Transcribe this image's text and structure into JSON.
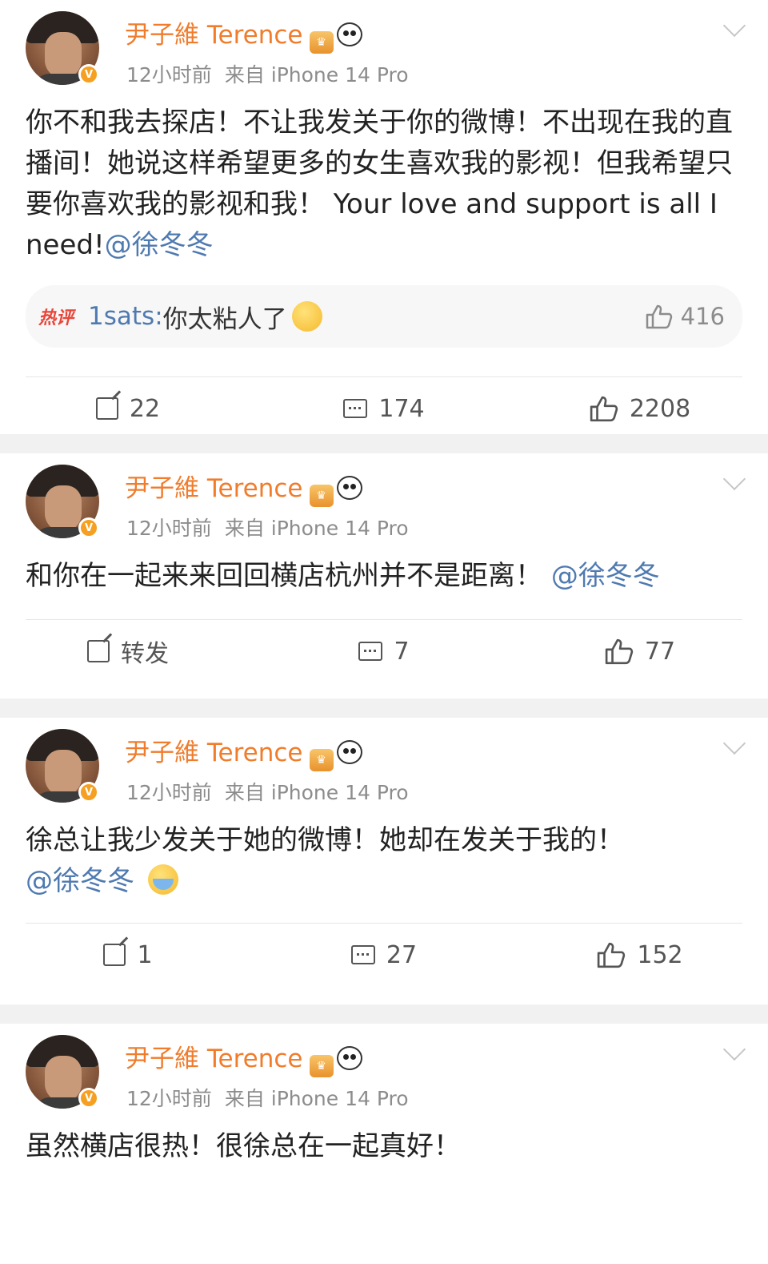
{
  "posts": [
    {
      "author": "尹子維 Terence",
      "time": "12小时前",
      "source": "来自 iPhone 14 Pro",
      "text": "你不和我去探店！不让我发关于你的微博！不出现在我的直播间！她说这样希望更多的女生喜欢我的影视！但我希望只要你喜欢我的影视和我！ Your love and support is all I need!",
      "mention": "@徐冬冬",
      "hot_comment": {
        "tag": "热评",
        "user": "1sats:",
        "text": " 你太粘人了",
        "likes": "416"
      },
      "share": "22",
      "comments": "174",
      "likes": "2208"
    },
    {
      "author": "尹子維 Terence",
      "time": "12小时前",
      "source": "来自 iPhone 14 Pro",
      "text": "和你在一起来来回回横店杭州并不是距离！",
      "mention": "@徐冬冬",
      "share": "转发",
      "comments": "7",
      "likes": "77"
    },
    {
      "author": "尹子維 Terence",
      "time": "12小时前",
      "source": "来自 iPhone 14 Pro",
      "text": "徐总让我少发关于她的微博！她却在发关于我的！",
      "mention": "@徐冬冬",
      "share": "1",
      "comments": "27",
      "likes": "152"
    },
    {
      "author": "尹子維 Terence",
      "time": "12小时前",
      "source": "来自 iPhone 14 Pro",
      "text": "虽然横店很热！很徐总在一起真好！"
    }
  ],
  "colors": {
    "name": "#f07c2c",
    "mention": "#4f7ab0",
    "hot_tag": "#e8463a",
    "badge": "#f6a022"
  },
  "icons": {
    "share": "share-icon",
    "comment": "comment-icon",
    "like": "thumbs-up-icon",
    "more": "chevron-down-icon",
    "vip": "crown-icon",
    "panda": "panda-icon"
  }
}
